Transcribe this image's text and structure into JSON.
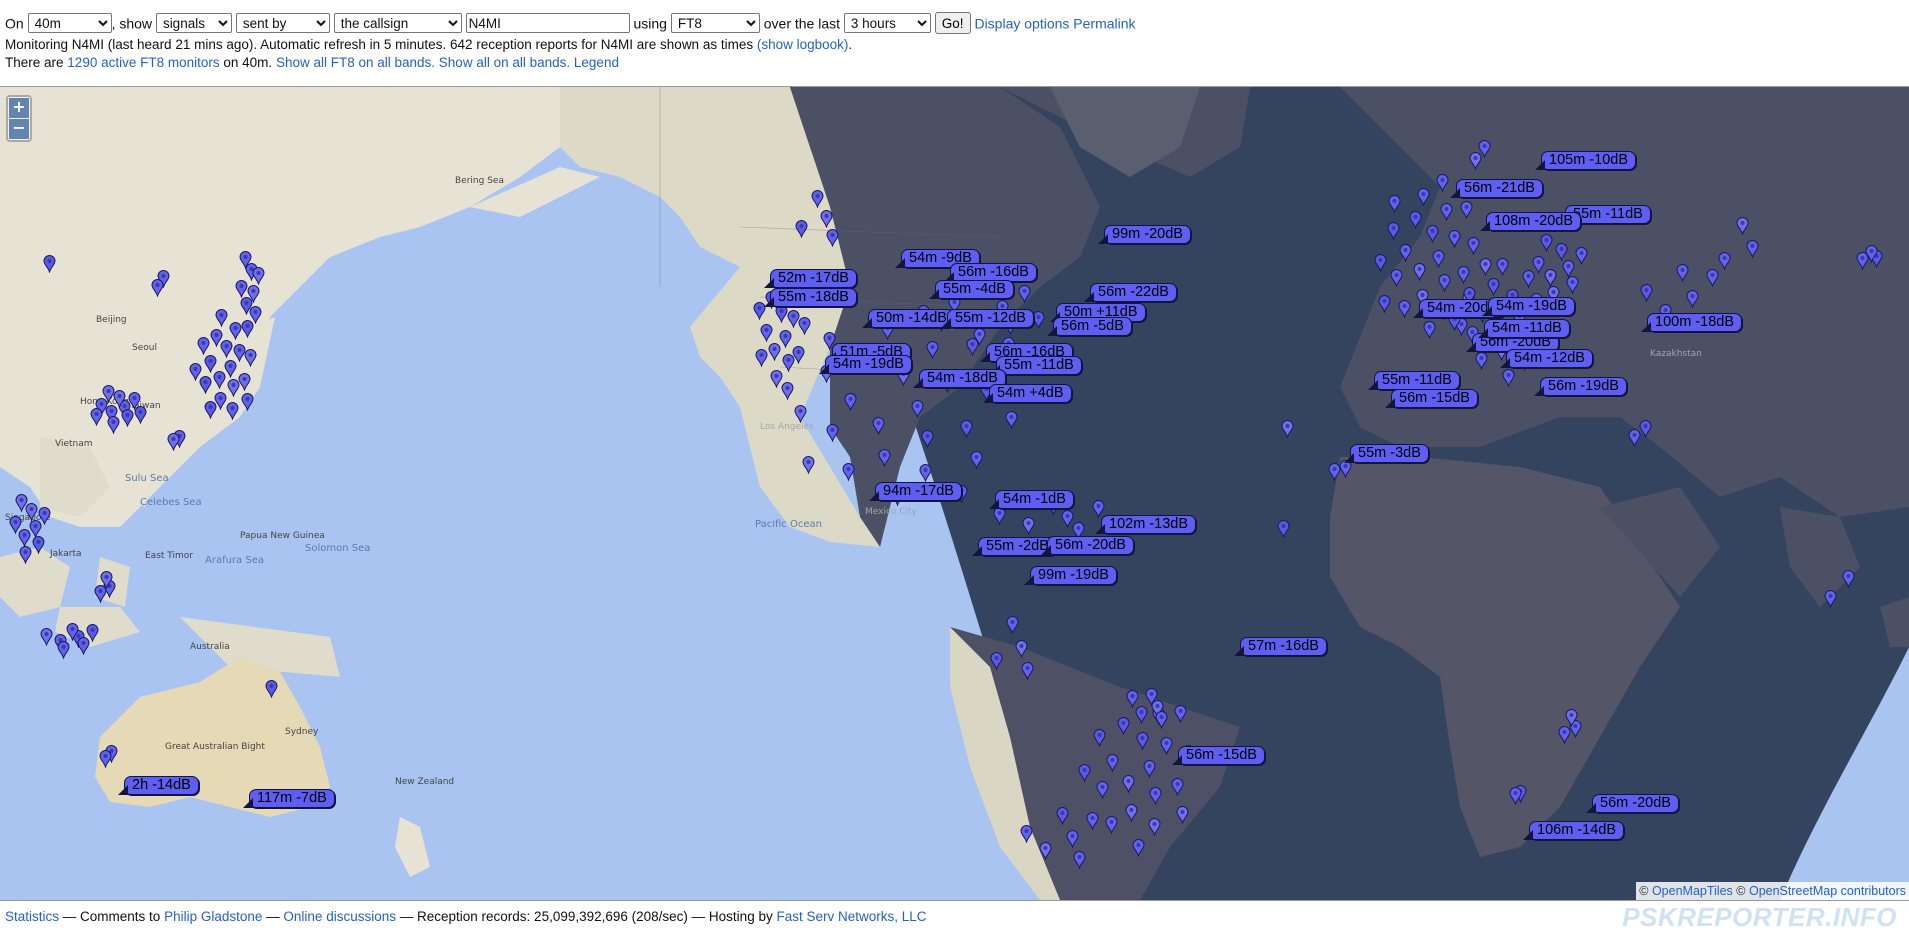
{
  "controls": {
    "on_label": "On",
    "band": "40m",
    "show_label": ", show",
    "show": "signals",
    "direction": "sent by",
    "target": "the callsign",
    "callsign": "N4MI",
    "using_label": "using",
    "mode": "FT8",
    "over_label": "over the last",
    "period": "3 hours",
    "go": "Go!",
    "display_options": "Display options",
    "permalink": "Permalink"
  },
  "info": {
    "monitoring_text": "Monitoring N4MI (last heard 21 mins ago). Automatic refresh in 5 minutes. 642 reception reports for N4MI are shown as times",
    "show_logbook": "(show logbook)",
    "period_end": ".",
    "there_are": "There are",
    "active_monitors": "1290 active FT8 monitors",
    "on_band": "on 40m.",
    "show_all_ft8": "Show all FT8 on all bands.",
    "show_all": "Show all on all bands.",
    "legend": "Legend"
  },
  "map": {
    "zoom_in": "+",
    "zoom_out": "−",
    "labels": [
      "Bering Sea",
      "Beijing",
      "Seoul",
      "Hong Kong",
      "Taiwan",
      "Vietnam",
      "Sulu Sea",
      "Celebes Sea",
      "Singapore",
      "Jakarta",
      "East Timor",
      "Arafura Sea",
      "Papua New Guinea",
      "Solomon Sea",
      "Pacific Ocean",
      "Australia",
      "Sydney",
      "Great Australian Bight",
      "New Zealand",
      "Los Angeles",
      "Mexico City",
      "Kazakhstan"
    ],
    "reports": [
      "105m -10dB",
      "56m -21dB",
      "55m -11dB",
      "108m -20dB",
      "99m -20dB",
      "54m -9dB",
      "56m -16dB",
      "52m -17dB",
      "55m -18dB",
      "55m -4dB",
      "56m -22dB",
      "50m -14dB",
      "55m -12dB",
      "50m +11dB",
      "56m -5dB",
      "51m -5dB",
      "54m -19dB",
      "56m -16dB",
      "55m -11dB",
      "54m -18dB",
      "54m +4dB",
      "94m -17dB",
      "54m -1dB",
      "102m -13dB",
      "55m -2dB",
      "56m -20dB",
      "99m -19dB",
      "56m -20dB",
      "54m -20dB",
      "54m -11dB",
      "54m -19dB",
      "100m -18dB",
      "54m -12dB",
      "56m -19dB",
      "55m -11dB",
      "56m -15dB",
      "55m -3dB",
      "57m -16dB",
      "56m -15dB",
      "56m -20dB",
      "106m -14dB",
      "2h -14dB",
      "117m -7dB"
    ],
    "attribution_copy": "©",
    "attribution_tiles": "OpenMapTiles",
    "attribution_osm": "OpenStreetMap contributors"
  },
  "footer": {
    "statistics": "Statistics",
    "comments_to": "— Comments to",
    "author": "Philip Gladstone",
    "sep1": "—",
    "discussions": "Online discussions",
    "records": "— Reception records: 25,099,392,696 (208/sec) — Hosting by",
    "host": "Fast Serv Networks, LLC"
  },
  "brand": "PSKREPORTER.INFO",
  "colors": {
    "marker": "#6262f0",
    "label_bg": "#5e5ef2",
    "link": "#2361c7",
    "night": "#34445f",
    "day_ocean": "#aac6f3",
    "day_land": "#e7e3d4"
  }
}
